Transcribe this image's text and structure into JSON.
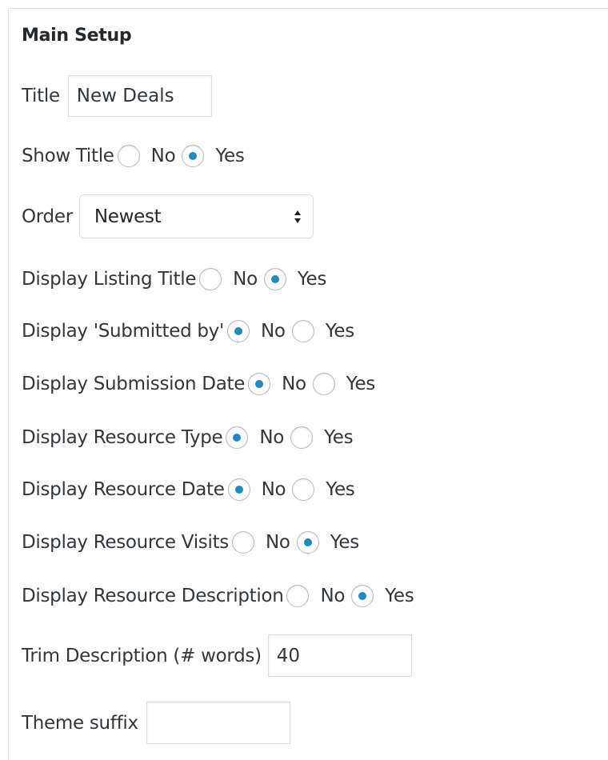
{
  "section": {
    "heading": "Main Setup"
  },
  "fields": {
    "title": {
      "label": "Title",
      "value": "New Deals"
    },
    "show_title": {
      "label": "Show Title",
      "options": [
        "No",
        "Yes"
      ],
      "selected": "Yes"
    },
    "order": {
      "label": "Order",
      "value": "Newest"
    },
    "display_listing_title": {
      "label": "Display Listing Title",
      "options": [
        "No",
        "Yes"
      ],
      "selected": "Yes"
    },
    "display_submitted_by": {
      "label": "Display 'Submitted by'",
      "options": [
        "No",
        "Yes"
      ],
      "selected": "No"
    },
    "display_submission_date": {
      "label": "Display Submission Date",
      "options": [
        "No",
        "Yes"
      ],
      "selected": "No"
    },
    "display_resource_type": {
      "label": "Display Resource Type",
      "options": [
        "No",
        "Yes"
      ],
      "selected": "No"
    },
    "display_resource_date": {
      "label": "Display Resource Date",
      "options": [
        "No",
        "Yes"
      ],
      "selected": "No"
    },
    "display_resource_visits": {
      "label": "Display Resource Visits",
      "options": [
        "No",
        "Yes"
      ],
      "selected": "Yes"
    },
    "display_resource_description": {
      "label": "Display Resource Description",
      "options": [
        "No",
        "Yes"
      ],
      "selected": "Yes"
    },
    "trim_description": {
      "label": "Trim Description (# words)",
      "value": "40"
    },
    "theme_suffix": {
      "label": "Theme suffix",
      "value": ""
    }
  },
  "colors": {
    "radio_checked": "#1e8cbe",
    "border": "#dddddd",
    "text": "#32373c"
  }
}
